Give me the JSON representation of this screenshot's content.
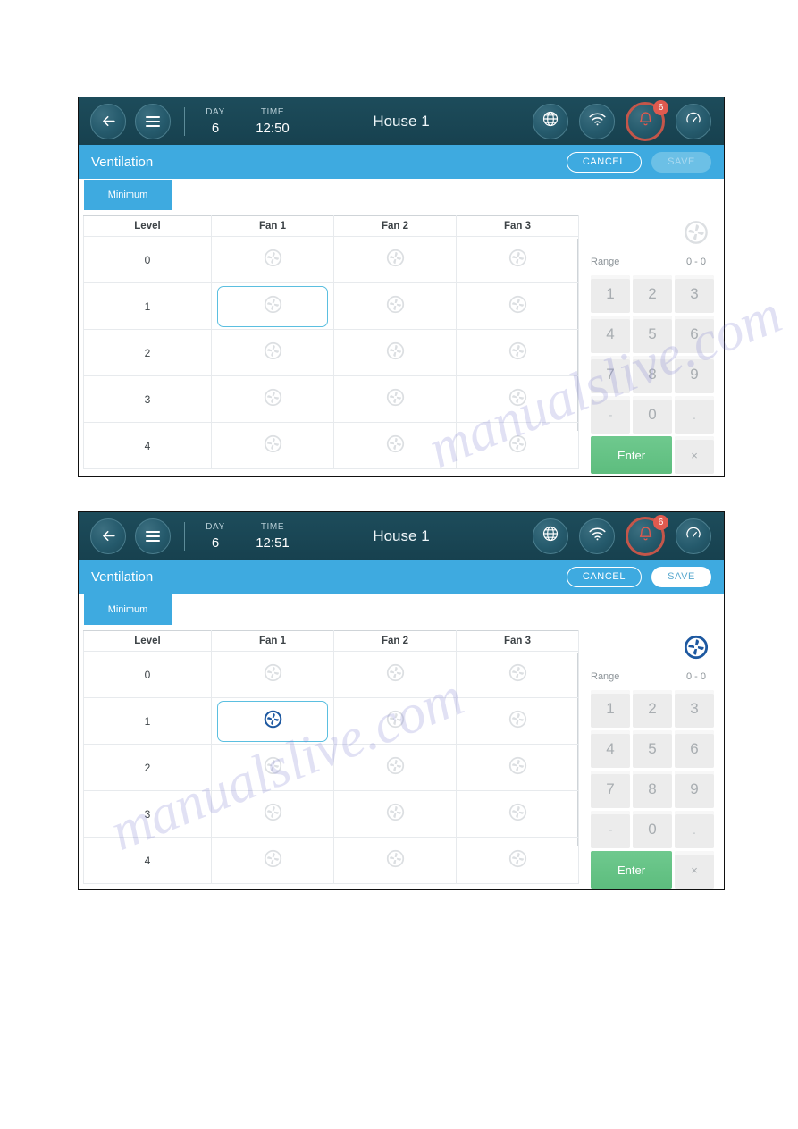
{
  "colors": {
    "header_bg": "#1d4c5b",
    "subbar_blue": "#3eaae0",
    "accent_blue": "#5bbfe0",
    "enter_green": "#5dbd7e",
    "alarm_red": "#e05a4f",
    "fan_active": "#1d58a0",
    "fan_inactive": "#dcdfe2"
  },
  "watermark": {
    "line1": "manualslive.com",
    "line2": "manualslive.com"
  },
  "panels": [
    {
      "id": "panel-1",
      "header": {
        "back_icon": "arrow-left-icon",
        "menu_icon": "hamburger-menu-icon",
        "day_label": "DAY",
        "day_value": "6",
        "time_label": "TIME",
        "time_value": "12:50",
        "house_title": "House 1",
        "icons": [
          {
            "name": "globe-icon",
            "label": "Network"
          },
          {
            "name": "wifi-icon",
            "label": "Wi-Fi"
          },
          {
            "name": "bell-icon",
            "label": "Alarms",
            "badge": "6"
          },
          {
            "name": "gauge-icon",
            "label": "Performance"
          }
        ]
      },
      "subbar": {
        "title": "Ventilation",
        "cancel_label": "CANCEL",
        "save_label": "SAVE",
        "save_enabled": false
      },
      "tabs": [
        {
          "label": "Minimum",
          "active": true
        }
      ],
      "table": {
        "columns": [
          "Level",
          "Fan 1",
          "Fan 2",
          "Fan 3"
        ],
        "rows": [
          {
            "level": "0",
            "fans": [
              "off",
              "off",
              "off"
            ]
          },
          {
            "level": "1",
            "fans": [
              "off",
              "off",
              "off"
            ]
          },
          {
            "level": "2",
            "fans": [
              "off",
              "off",
              "off"
            ]
          },
          {
            "level": "3",
            "fans": [
              "off",
              "off",
              "off"
            ]
          },
          {
            "level": "4",
            "fans": [
              "off",
              "off",
              "off"
            ]
          }
        ],
        "selected_cell": {
          "row": 1,
          "col": 0
        }
      },
      "keypad": {
        "fan_indicator": "inactive",
        "range_label": "Range",
        "range_value": "0 - 0",
        "keys": [
          "1",
          "2",
          "3",
          "4",
          "5",
          "6",
          "7",
          "8",
          "9",
          "-",
          "0",
          "."
        ],
        "enter_label": "Enter",
        "clear_label": "×"
      }
    },
    {
      "id": "panel-2",
      "header": {
        "back_icon": "arrow-left-icon",
        "menu_icon": "hamburger-menu-icon",
        "day_label": "DAY",
        "day_value": "6",
        "time_label": "TIME",
        "time_value": "12:51",
        "house_title": "House 1",
        "icons": [
          {
            "name": "globe-icon",
            "label": "Network"
          },
          {
            "name": "wifi-icon",
            "label": "Wi-Fi"
          },
          {
            "name": "bell-icon",
            "label": "Alarms",
            "badge": "6"
          },
          {
            "name": "gauge-icon",
            "label": "Performance"
          }
        ]
      },
      "subbar": {
        "title": "Ventilation",
        "cancel_label": "CANCEL",
        "save_label": "SAVE",
        "save_enabled": true
      },
      "tabs": [
        {
          "label": "Minimum",
          "active": true
        }
      ],
      "table": {
        "columns": [
          "Level",
          "Fan 1",
          "Fan 2",
          "Fan 3"
        ],
        "rows": [
          {
            "level": "0",
            "fans": [
              "off",
              "off",
              "off"
            ]
          },
          {
            "level": "1",
            "fans": [
              "on",
              "off",
              "off"
            ]
          },
          {
            "level": "2",
            "fans": [
              "off",
              "off",
              "off"
            ]
          },
          {
            "level": "3",
            "fans": [
              "off",
              "off",
              "off"
            ]
          },
          {
            "level": "4",
            "fans": [
              "off",
              "off",
              "off"
            ]
          }
        ],
        "selected_cell": {
          "row": 1,
          "col": 0
        }
      },
      "keypad": {
        "fan_indicator": "active",
        "range_label": "Range",
        "range_value": "0 - 0",
        "keys": [
          "1",
          "2",
          "3",
          "4",
          "5",
          "6",
          "7",
          "8",
          "9",
          "-",
          "0",
          "."
        ],
        "enter_label": "Enter",
        "clear_label": "×"
      }
    }
  ]
}
